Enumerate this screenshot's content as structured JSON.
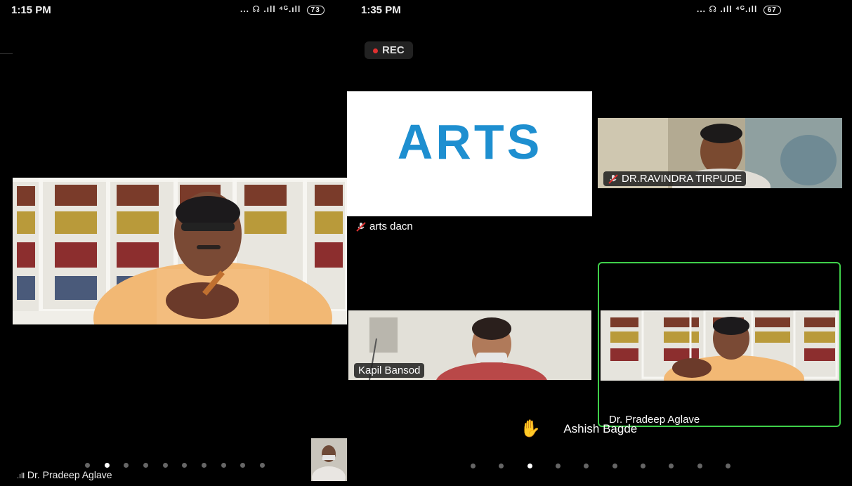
{
  "left": {
    "status_time": "1:15 PM",
    "status_icons": "... ☊ .ıll ⁴ᴳ.ıll",
    "battery": "73",
    "signal_label": ".ıll",
    "speaker_name": "Dr. Pradeep Aglave"
  },
  "right": {
    "status_time": "1:35 PM",
    "status_icons": "... ☊ .ıll ⁴ᴳ.ıll",
    "battery": "67",
    "rec_label": "REC",
    "arts_logo": "ARTS",
    "arts_name": "arts dacn",
    "ravindra_name": "DR.RAVINDRA TIRPUDE",
    "kapil_name": "Kapil Bansod",
    "pradeep_name": "Dr. Pradeep Aglave",
    "raised_hand_name": "Ashish Bagde"
  },
  "colors": {
    "active_border": "#3fd04a",
    "arts_blue": "#1e8fd0",
    "rec_red": "#e03030"
  }
}
